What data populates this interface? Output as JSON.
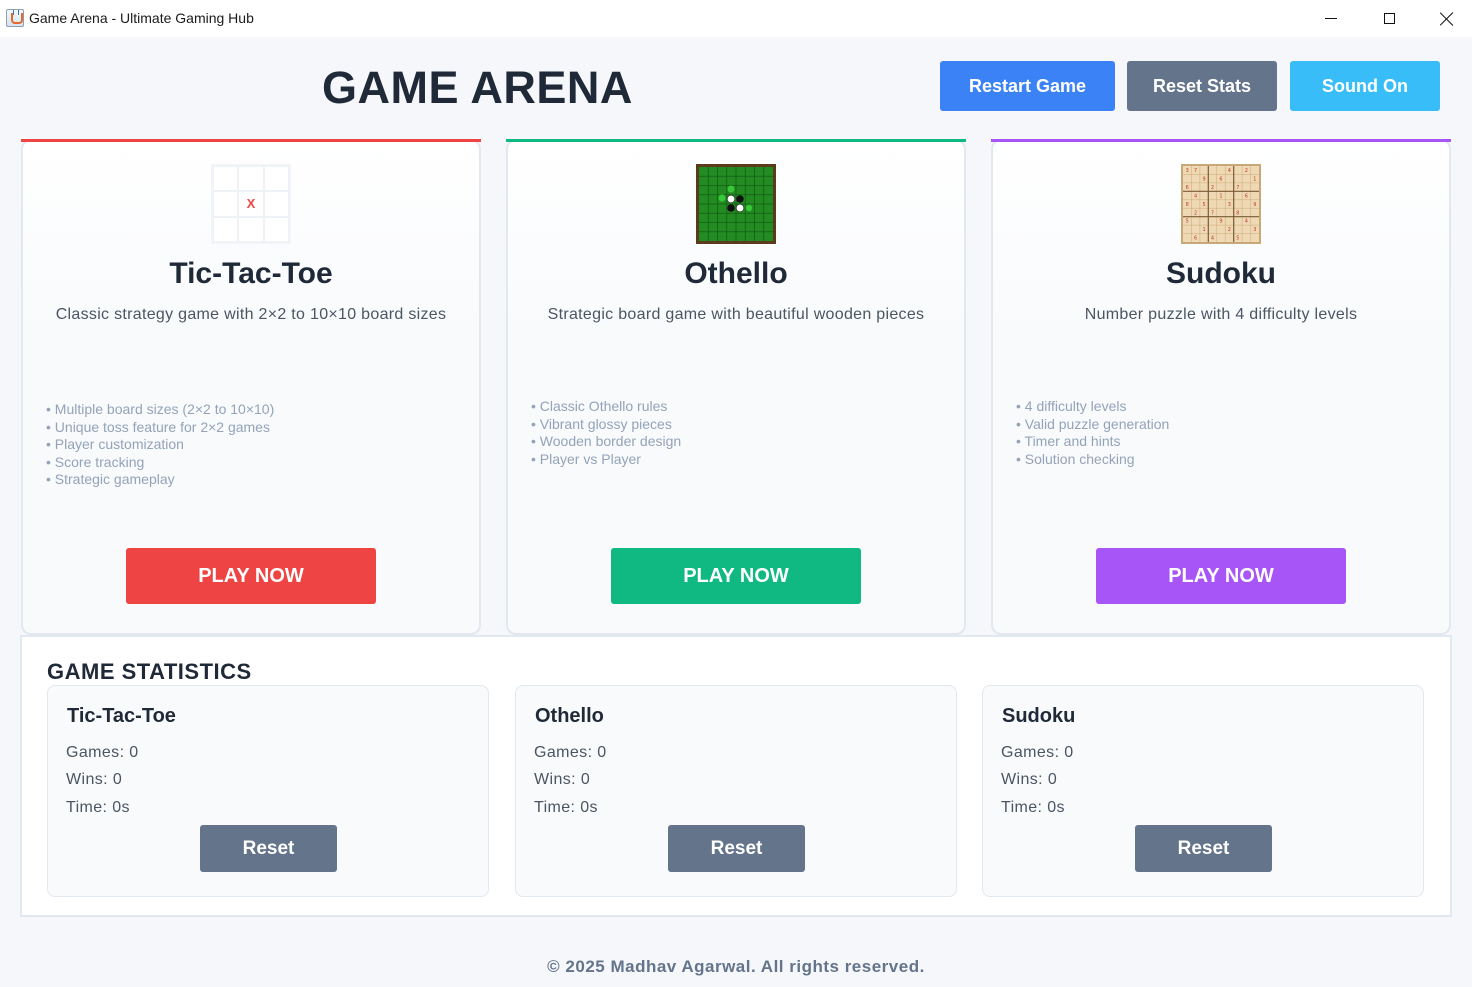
{
  "window": {
    "title": "Game Arena - Ultimate Gaming Hub"
  },
  "header": {
    "title": "GAME ARENA",
    "restart_label": "Restart Game",
    "reset_stats_label": "Reset Stats",
    "sound_label": "Sound On"
  },
  "colors": {
    "tic_tac_toe": "#ef4444",
    "othello": "#10b981",
    "sudoku": "#a855f7",
    "restart": "#3b82f6",
    "reset": "#64748b",
    "sound": "#38bdf8"
  },
  "games": [
    {
      "name": "Tic-Tac-Toe",
      "icon": "tic-tac-toe-board-icon",
      "description": "Classic strategy game with 2×2 to 10×10 board sizes",
      "features": [
        "• Multiple board sizes (2×2 to 10×10)",
        "• Unique toss feature for 2×2 games",
        "• Player customization",
        "• Score tracking",
        "• Strategic gameplay"
      ],
      "play_label": "PLAY NOW",
      "thumb_mark": "X"
    },
    {
      "name": "Othello",
      "icon": "othello-board-icon",
      "description": "Strategic board game with beautiful wooden pieces",
      "features": [
        "• Classic Othello rules",
        "• Vibrant glossy pieces",
        "• Wooden border design",
        "• Player vs Player"
      ],
      "play_label": "PLAY NOW"
    },
    {
      "name": "Sudoku",
      "icon": "sudoku-grid-icon",
      "description": "Number puzzle with 4 difficulty levels",
      "features": [
        "• 4 difficulty levels",
        "• Valid puzzle generation",
        "• Timer and hints",
        "• Solution checking"
      ],
      "play_label": "PLAY NOW"
    }
  ],
  "stats": {
    "title": "GAME STATISTICS",
    "boxes": [
      {
        "name": "Tic-Tac-Toe",
        "games": "Games: 0",
        "wins": "Wins: 0",
        "time": "Time: 0s",
        "reset_label": "Reset"
      },
      {
        "name": "Othello",
        "games": "Games: 0",
        "wins": "Wins: 0",
        "time": "Time: 0s",
        "reset_label": "Reset"
      },
      {
        "name": "Sudoku",
        "games": "Games: 0",
        "wins": "Wins: 0",
        "time": "Time: 0s",
        "reset_label": "Reset"
      }
    ]
  },
  "footer": "© 2025 Madhav Agarwal. All rights reserved."
}
